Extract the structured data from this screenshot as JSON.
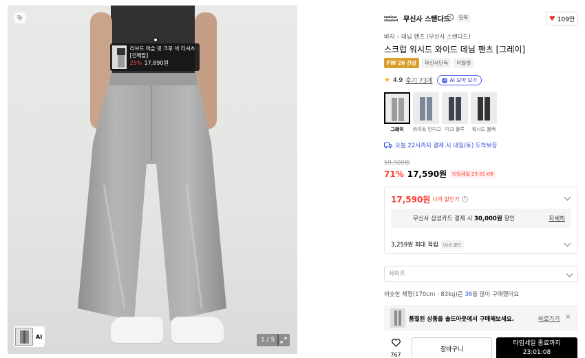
{
  "image_panel": {
    "tag_icon": "tag-icon",
    "pin": {
      "product_name": "리브드 머슬 핏 크루 넥 티셔츠 [건메탈]",
      "discount": "25%",
      "price": "17,890원"
    },
    "thumb_ai_label": "AI",
    "counter": "1 / 5",
    "expand_icon": "expand-icon"
  },
  "brand": {
    "logo_text": "musinsa standard",
    "name": "무신사 스탠다드",
    "badge": "단독",
    "likes": "109만"
  },
  "breadcrumb": [
    "바지",
    "데님 팬츠 (무신사 스탠다드)"
  ],
  "product": {
    "title": "스크럽 워시드 와이드 데님 팬츠 [그레이]",
    "chips": [
      "FW 26 신상",
      "무신사단독",
      "이월렛"
    ],
    "rating": "4.9",
    "reviews": "후기 73개",
    "ai_summary": "AI 요약 보기"
  },
  "swatches": [
    {
      "label": "그레이",
      "selected": true
    },
    {
      "label": "라이트 인디고",
      "selected": false
    },
    {
      "label": "다크 블루",
      "selected": false
    },
    {
      "label": "워시드 블랙",
      "selected": false
    }
  ],
  "delivery": "오늘 22시까지 결제 시 내일(토) 도착보장",
  "pricing": {
    "original": "59,900원",
    "discount_pct": "71%",
    "price": "17,590원",
    "timer_badge": "타임세일 23:01:08"
  },
  "benefit": {
    "my_price": "17,590원",
    "my_price_label": "나의 할인가",
    "card_offer_prefix": "무신사 삼성카드 결제 시 ",
    "card_offer_bold": "30,000원",
    "card_offer_suffix": " 할인",
    "card_offer_more": "자세히",
    "points": "3,259원 최대 적립",
    "level": "LV.6 골드"
  },
  "size_select": {
    "placeholder": "사이즈"
  },
  "similar": {
    "prefix": "비슷한 체형(170cm · 83kg)은 ",
    "size": "36",
    "suffix": "을 많이 구매했어요"
  },
  "soldout": {
    "message": "품절된 상품을 솔드아웃에서 구매해보세요.",
    "link": "바로가기",
    "close": "×"
  },
  "bottom_bar": {
    "wish_count": "767",
    "cart_label": "장바구니",
    "buy_line1": "타임세일 종료까지",
    "buy_line2": "23:01:08"
  },
  "colors": {
    "accent_red": "#ff3b30",
    "link_blue": "#2b4dd8",
    "season_chip": "#d99e2b"
  }
}
